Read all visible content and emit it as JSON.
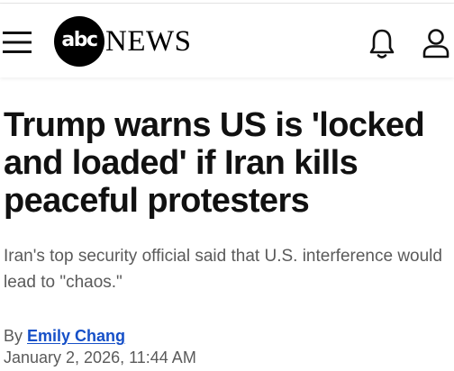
{
  "header": {
    "logo_circle_text": "abc",
    "logo_text": "NEWS",
    "icons": [
      "menu-icon",
      "bell-icon",
      "user-icon"
    ]
  },
  "article": {
    "headline": "Trump warns US is 'locked and loaded' if Iran kills peaceful protesters",
    "subhead": "Iran's top security official said that U.S. interference would lead to \"chaos.\"",
    "byline_prefix": "By ",
    "author": "Emily Chang",
    "timestamp": "January 2, 2026, 11:44 AM"
  },
  "colors": {
    "link": "#1650c8",
    "meta_text": "#5a5a5a",
    "headline": "#111111"
  }
}
